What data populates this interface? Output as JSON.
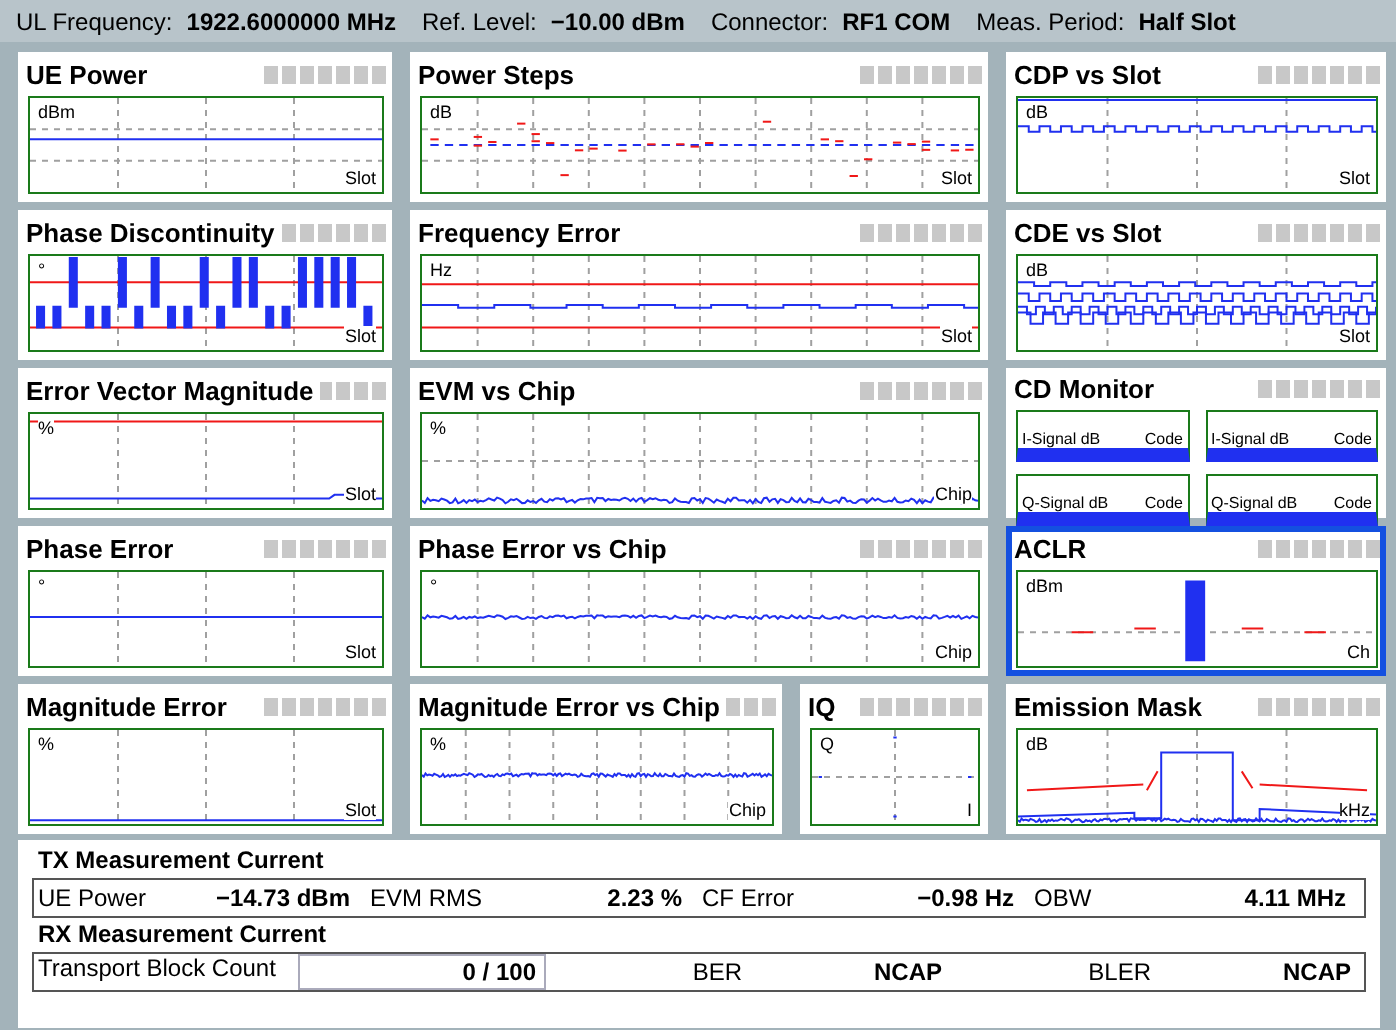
{
  "header": [
    {
      "label": "UL Frequency:",
      "value": "1922.6000000 MHz"
    },
    {
      "label": "Ref. Level:",
      "value": "−10.00 dBm"
    },
    {
      "label": "Connector:",
      "value": "RF1 COM"
    },
    {
      "label": "Meas. Period:",
      "value": "Half Slot"
    }
  ],
  "rows": [
    [
      {
        "title": "UE Power",
        "kind": "level",
        "selected": false,
        "unit": "dBm",
        "axis": "Slot"
      },
      {
        "title": "Power Steps",
        "kind": "steps",
        "selected": false,
        "unit": "dB",
        "axis": "Slot"
      },
      {
        "title": "CDP vs Slot",
        "kind": "cdp",
        "selected": false,
        "unit": "dB",
        "axis": "Slot"
      }
    ],
    [
      {
        "title": "Phase Discontinuity",
        "kind": "bars",
        "selected": false,
        "unit": "°",
        "axis": "Slot"
      },
      {
        "title": "Frequency Error",
        "kind": "freq",
        "selected": false,
        "unit": "Hz",
        "axis": "Slot"
      },
      {
        "title": "CDE vs Slot",
        "kind": "cde",
        "selected": false,
        "unit": "dB",
        "axis": "Slot"
      }
    ],
    [
      {
        "title": "Error Vector Magnitude",
        "kind": "evm",
        "selected": false,
        "unit": "%",
        "axis": "Slot"
      },
      {
        "title": "EVM vs Chip",
        "kind": "noise-low",
        "selected": false,
        "unit": "%",
        "axis": "Chip"
      },
      {
        "title": "CD Monitor",
        "kind": "cd-monitor",
        "selected": false,
        "panels": [
          {
            "label": "I-Signal dB",
            "axis": "Code"
          },
          {
            "label": "I-Signal dB",
            "axis": "Code"
          },
          {
            "label": "Q-Signal dB",
            "axis": "Code"
          },
          {
            "label": "Q-Signal dB",
            "axis": "Code"
          }
        ]
      }
    ],
    [
      {
        "title": "Phase Error",
        "kind": "flat-mid",
        "selected": false,
        "unit": "°",
        "axis": "Slot"
      },
      {
        "title": "Phase Error vs Chip",
        "kind": "noise-mid",
        "selected": false,
        "unit": "°",
        "axis": "Chip"
      },
      {
        "title": "ACLR",
        "kind": "aclr",
        "selected": true,
        "unit": "dBm",
        "axis": "Ch"
      }
    ],
    [
      {
        "title": "Magnitude Error",
        "kind": "flat-low",
        "selected": false,
        "unit": "%",
        "axis": "Slot"
      },
      {
        "title": "Magnitude Error vs Chip",
        "kind": "noise-high",
        "selected": false,
        "unit": "%",
        "axis": "Chip"
      },
      {
        "title": "IQ",
        "kind": "iq",
        "selected": false,
        "unit": "Q",
        "axis": "I"
      },
      {
        "title": "Emission Mask",
        "kind": "mask",
        "selected": false,
        "unit": "dB",
        "axis": "kHz"
      }
    ]
  ],
  "tx": {
    "title": "TX Measurement Current",
    "items": [
      {
        "label": "UE Power",
        "value": "−14.73 dBm"
      },
      {
        "label": "EVM RMS",
        "value": "2.23 %"
      },
      {
        "label": "CF Error",
        "value": "−0.98 Hz"
      },
      {
        "label": "OBW",
        "value": "4.11 MHz"
      }
    ]
  },
  "rx": {
    "title": "RX Measurement Current",
    "items": [
      {
        "label": "Transport Block Count",
        "value": "0 / 100",
        "kind": "field"
      },
      {
        "label": "BER",
        "value": "NCAP",
        "kind": "text"
      },
      {
        "label": "BLER",
        "value": "NCAP",
        "kind": "text"
      }
    ]
  }
}
